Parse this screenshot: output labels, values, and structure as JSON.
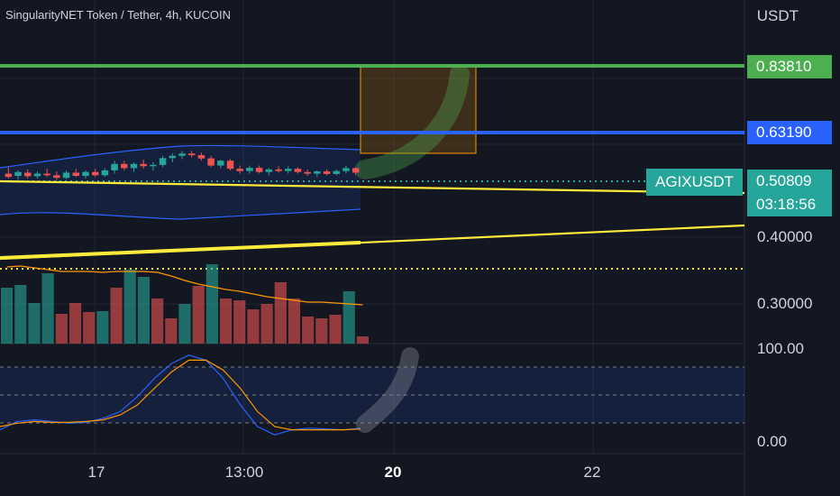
{
  "header": {
    "title": "SingularityNET Token / Tether, 4h, KUCOIN"
  },
  "price_axis": {
    "currency": "USDT",
    "labels": [
      "0.40000",
      "0.30000"
    ]
  },
  "indicator_axis": {
    "labels": [
      "100.00",
      "0.00"
    ]
  },
  "price_tags": {
    "target_line": "0.83810",
    "resistance_line": "0.63190",
    "current_price": "0.50809",
    "countdown": "03:18:56",
    "symbol": "AGIXUSDT"
  },
  "time_axis": {
    "labels": [
      {
        "text": "17",
        "bold": false
      },
      {
        "text": "13:00",
        "bold": false
      },
      {
        "text": "20",
        "bold": true
      },
      {
        "text": "22",
        "bold": false
      }
    ]
  },
  "colors": {
    "background": "#131722",
    "green_line": "#4caf50",
    "blue_line": "#2962ff",
    "yellow_line": "#ffeb3b",
    "candle_up": "#26a69a",
    "candle_down": "#ef5350",
    "band": "#2962ff",
    "k_line": "#2962ff",
    "d_line": "#ff9800"
  },
  "chart_data": [
    {
      "type": "candlestick",
      "title": "SingularityNET Token / Tether, 4h, KUCOIN",
      "y_unit": "USDT",
      "y_ticks": [
        0.3,
        0.4
      ],
      "horizontal_levels": [
        0.8381,
        0.6319
      ],
      "current_price": 0.50809,
      "candles": [
        {
          "o": 0.505,
          "h": 0.525,
          "l": 0.49,
          "c": 0.495
        },
        {
          "o": 0.498,
          "h": 0.515,
          "l": 0.485,
          "c": 0.51
        },
        {
          "o": 0.508,
          "h": 0.518,
          "l": 0.49,
          "c": 0.497
        },
        {
          "o": 0.497,
          "h": 0.512,
          "l": 0.49,
          "c": 0.505
        },
        {
          "o": 0.505,
          "h": 0.52,
          "l": 0.495,
          "c": 0.5
        },
        {
          "o": 0.5,
          "h": 0.512,
          "l": 0.485,
          "c": 0.492
        },
        {
          "o": 0.492,
          "h": 0.515,
          "l": 0.488,
          "c": 0.508
        },
        {
          "o": 0.508,
          "h": 0.52,
          "l": 0.495,
          "c": 0.498
        },
        {
          "o": 0.498,
          "h": 0.515,
          "l": 0.49,
          "c": 0.51
        },
        {
          "o": 0.51,
          "h": 0.52,
          "l": 0.495,
          "c": 0.5
        },
        {
          "o": 0.5,
          "h": 0.522,
          "l": 0.495,
          "c": 0.515
        },
        {
          "o": 0.515,
          "h": 0.545,
          "l": 0.505,
          "c": 0.535
        },
        {
          "o": 0.535,
          "h": 0.545,
          "l": 0.515,
          "c": 0.522
        },
        {
          "o": 0.522,
          "h": 0.54,
          "l": 0.51,
          "c": 0.535
        },
        {
          "o": 0.535,
          "h": 0.548,
          "l": 0.52,
          "c": 0.528
        },
        {
          "o": 0.528,
          "h": 0.54,
          "l": 0.515,
          "c": 0.532
        },
        {
          "o": 0.532,
          "h": 0.56,
          "l": 0.525,
          "c": 0.553
        },
        {
          "o": 0.553,
          "h": 0.568,
          "l": 0.54,
          "c": 0.56
        },
        {
          "o": 0.56,
          "h": 0.575,
          "l": 0.55,
          "c": 0.567
        },
        {
          "o": 0.567,
          "h": 0.575,
          "l": 0.555,
          "c": 0.562
        },
        {
          "o": 0.562,
          "h": 0.57,
          "l": 0.545,
          "c": 0.552
        },
        {
          "o": 0.552,
          "h": 0.56,
          "l": 0.525,
          "c": 0.53
        },
        {
          "o": 0.53,
          "h": 0.548,
          "l": 0.522,
          "c": 0.545
        },
        {
          "o": 0.545,
          "h": 0.55,
          "l": 0.515,
          "c": 0.52
        },
        {
          "o": 0.52,
          "h": 0.53,
          "l": 0.505,
          "c": 0.513
        },
        {
          "o": 0.513,
          "h": 0.53,
          "l": 0.505,
          "c": 0.523
        },
        {
          "o": 0.523,
          "h": 0.53,
          "l": 0.505,
          "c": 0.51
        },
        {
          "o": 0.51,
          "h": 0.522,
          "l": 0.5,
          "c": 0.518
        },
        {
          "o": 0.518,
          "h": 0.528,
          "l": 0.508,
          "c": 0.513
        },
        {
          "o": 0.513,
          "h": 0.528,
          "l": 0.505,
          "c": 0.52
        },
        {
          "o": 0.52,
          "h": 0.525,
          "l": 0.505,
          "c": 0.51
        },
        {
          "o": 0.51,
          "h": 0.518,
          "l": 0.498,
          "c": 0.505
        },
        {
          "o": 0.505,
          "h": 0.515,
          "l": 0.495,
          "c": 0.512
        },
        {
          "o": 0.512,
          "h": 0.518,
          "l": 0.5,
          "c": 0.504
        },
        {
          "o": 0.504,
          "h": 0.518,
          "l": 0.5,
          "c": 0.513
        },
        {
          "o": 0.513,
          "h": 0.53,
          "l": 0.505,
          "c": 0.522
        },
        {
          "o": 0.522,
          "h": 0.525,
          "l": 0.5,
          "c": 0.50809
        }
      ],
      "volume": [
        0.62,
        0.65,
        0.45,
        0.78,
        0.33,
        0.45,
        0.35,
        0.36,
        0.62,
        0.82,
        0.74,
        0.5,
        0.28,
        0.44,
        0.64,
        0.88,
        0.5,
        0.48,
        0.38,
        0.44,
        0.68,
        0.5,
        0.3,
        0.28,
        0.32,
        0.58,
        0.08
      ],
      "volume_ma": [
        0.85,
        0.86,
        0.84,
        0.82,
        0.8,
        0.8,
        0.8,
        0.79,
        0.8,
        0.8,
        0.8,
        0.79,
        0.75,
        0.7,
        0.66,
        0.63,
        0.6,
        0.58,
        0.55,
        0.52,
        0.5,
        0.48,
        0.46,
        0.46,
        0.45,
        0.44,
        0.43
      ],
      "oscillator_k": [
        8,
        18,
        20,
        18,
        16,
        17,
        22,
        30,
        48,
        70,
        88,
        98,
        92,
        70,
        38,
        12,
        2,
        8,
        10,
        9,
        8,
        10
      ],
      "oscillator_d": [
        12,
        16,
        18,
        17,
        17,
        18,
        20,
        26,
        38,
        58,
        78,
        92,
        92,
        80,
        58,
        30,
        12,
        8,
        8,
        8,
        8,
        9
      ],
      "oscillator_ticks": [
        0,
        100
      ]
    }
  ]
}
